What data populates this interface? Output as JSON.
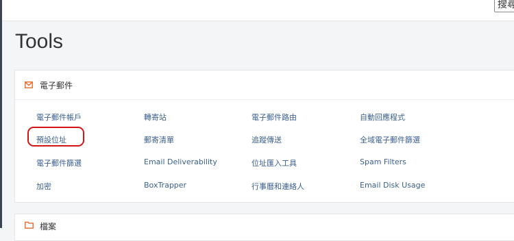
{
  "search": {
    "label": "搜尋"
  },
  "page": {
    "title": "Tools"
  },
  "email_section": {
    "title": "電子郵件",
    "icon": "envelope-icon",
    "items": [
      {
        "label": "電子郵件帳戶"
      },
      {
        "label": "轉寄站"
      },
      {
        "label": "電子郵件路由"
      },
      {
        "label": "自動回應程式"
      },
      {
        "label": "預設位址"
      },
      {
        "label": "郵寄清單"
      },
      {
        "label": "追蹤傳送"
      },
      {
        "label": "全域電子郵件篩選"
      },
      {
        "label": "電子郵件篩選"
      },
      {
        "label": "Email Deliverability"
      },
      {
        "label": "位址匯入工具"
      },
      {
        "label": "Spam Filters"
      },
      {
        "label": "加密"
      },
      {
        "label": "BoxTrapper"
      },
      {
        "label": "行事曆和連絡人"
      },
      {
        "label": "Email Disk Usage"
      }
    ]
  },
  "files_section": {
    "title": "檔案",
    "icon": "folder-icon"
  },
  "colors": {
    "accent_icon": "#e8743b",
    "link": "#3a5f8f",
    "highlight": "#d31414"
  }
}
